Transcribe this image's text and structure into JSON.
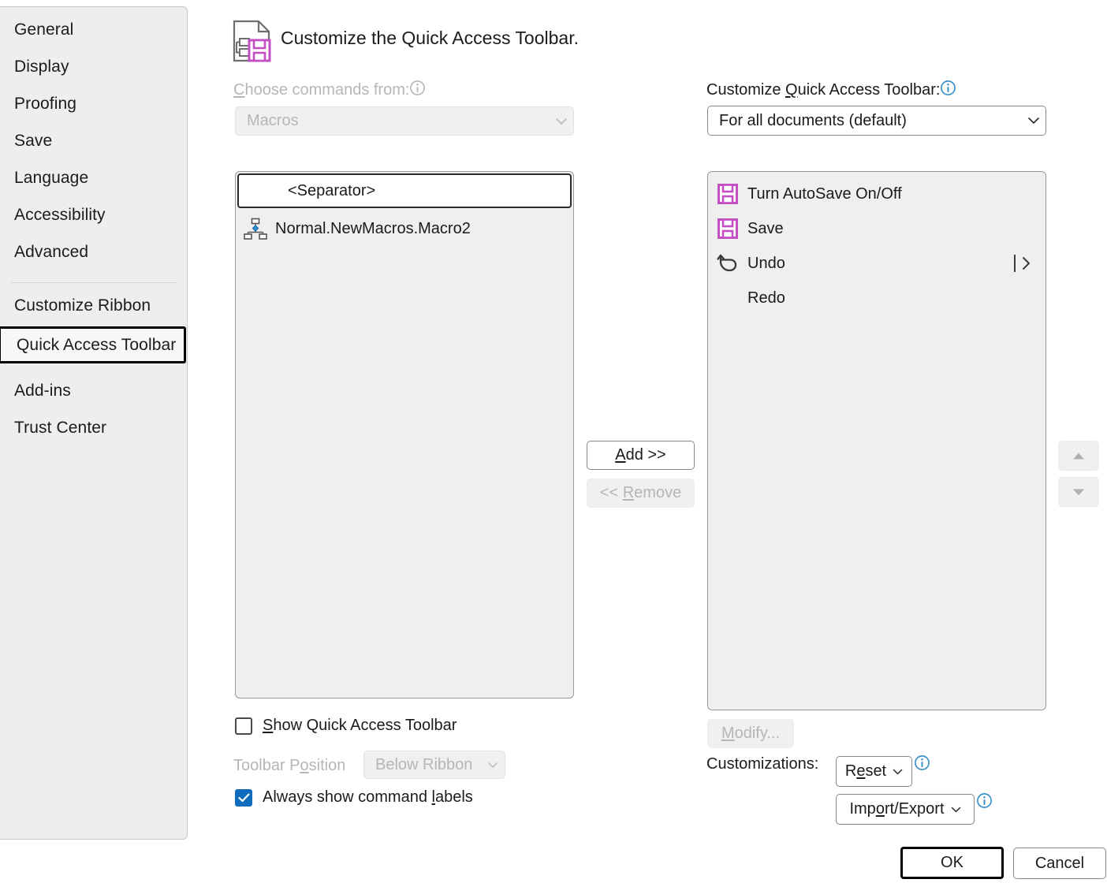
{
  "sidebar": {
    "items": [
      {
        "label": "General",
        "selected": false
      },
      {
        "label": "Display",
        "selected": false
      },
      {
        "label": "Proofing",
        "selected": false
      },
      {
        "label": "Save",
        "selected": false
      },
      {
        "label": "Language",
        "selected": false
      },
      {
        "label": "Accessibility",
        "selected": false
      },
      {
        "label": "Advanced",
        "selected": false
      },
      {
        "label": "Customize Ribbon",
        "selected": false
      },
      {
        "label": "Quick Access Toolbar",
        "selected": true
      },
      {
        "label": "Add-ins",
        "selected": false
      },
      {
        "label": "Trust Center",
        "selected": false
      }
    ]
  },
  "header": {
    "title": "Customize the Quick Access Toolbar.",
    "icon": "document-save-icon"
  },
  "left_panel": {
    "choose_label_pre": "C",
    "choose_label_post": "hoose commands from:",
    "choose_label_full": "Choose commands from:",
    "info_icon": "info-icon",
    "dropdown_value": "Macros",
    "dropdown_enabled": false,
    "commands": [
      {
        "label": "<Separator>",
        "icon": "none",
        "selected": true
      },
      {
        "label": "Normal.NewMacros.Macro2",
        "icon": "macro-hierarchy-icon",
        "selected": false
      }
    ],
    "show_qat_checkbox": {
      "label_pre": "S",
      "label_post": "how Quick Access Toolbar",
      "label_full": "Show Quick Access Toolbar",
      "checked": false
    },
    "toolbar_position_label_pre": "Toolbar P",
    "toolbar_position_label_mid": "o",
    "toolbar_position_label_post": "sition",
    "toolbar_position_label_full": "Toolbar Position",
    "toolbar_position_value": "Below Ribbon",
    "toolbar_position_enabled": false,
    "always_labels_checkbox": {
      "label_pre": "Always show command ",
      "label_mid": "l",
      "label_post": "abels",
      "label_full": "Always show command labels",
      "checked": true
    }
  },
  "middle_buttons": {
    "add": {
      "pre": "A",
      "post": "dd >>",
      "full": "Add >>",
      "enabled": true
    },
    "remove": {
      "pre": "<< ",
      "mid": "R",
      "post": "emove",
      "full": "<< Remove",
      "enabled": false
    }
  },
  "right_panel": {
    "customize_label_pre": "Customize ",
    "customize_label_mid": "Q",
    "customize_label_post": "uick Access Toolbar:",
    "customize_label_full": "Customize Quick Access Toolbar:",
    "dropdown_value": "For all documents (default)",
    "dropdown_enabled": true,
    "commands": [
      {
        "label": "Turn AutoSave On/Off",
        "icon": "floppy-save-icon",
        "more": false
      },
      {
        "label": "Save",
        "icon": "floppy-save-icon",
        "more": false
      },
      {
        "label": "Undo",
        "icon": "undo-arrow-icon",
        "more": true,
        "more_glyph": "|>"
      },
      {
        "label": "Redo",
        "icon": "none",
        "more": false
      }
    ],
    "modify_button": {
      "pre": "M",
      "post": "odify...",
      "full": "Modify...",
      "enabled": false
    },
    "customizations_label": "Customizations:",
    "reset_button": {
      "pre": "R",
      "mid": "e",
      "post": "set",
      "full": "Reset",
      "enabled": true,
      "has_chevron": true
    },
    "import_export_button": {
      "pre": "Imp",
      "mid": "o",
      "post": "rt/Export",
      "full": "Import/Export",
      "enabled": true,
      "has_chevron": true
    },
    "move_up_button": {
      "name": "Move Up",
      "enabled": false
    },
    "move_down_button": {
      "name": "Move Down",
      "enabled": false
    }
  },
  "footer": {
    "ok": "OK",
    "cancel": "Cancel"
  },
  "colors": {
    "accent_blue": "#0f6cbd",
    "info_blue": "#3b92c9",
    "save_purple": "#c34fc3",
    "sidebar_bg": "#eeeeee",
    "listbox_bg": "#efefef",
    "disabled_text": "#b6b6b6"
  }
}
